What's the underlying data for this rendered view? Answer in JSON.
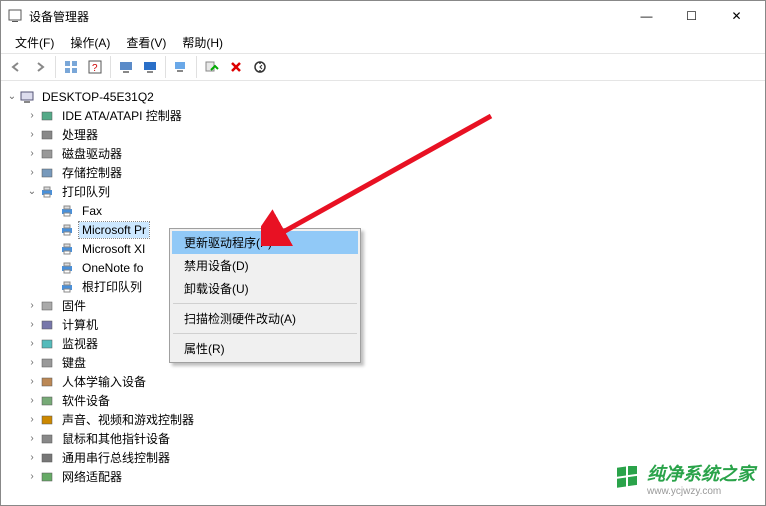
{
  "window": {
    "title": "设备管理器",
    "controls": {
      "min": "—",
      "max": "☐",
      "close": "✕"
    }
  },
  "menubar": [
    {
      "label": "文件(F)"
    },
    {
      "label": "操作(A)"
    },
    {
      "label": "查看(V)"
    },
    {
      "label": "帮助(H)"
    }
  ],
  "toolbar_icons": [
    "nav-back",
    "nav-fwd",
    "properties-grid",
    "help-pane",
    "scan-monitor",
    "scan-blue",
    "devices-view",
    "monitor-settings",
    "uninstall-green",
    "delete-red",
    "refresh-circle"
  ],
  "tree": {
    "root": {
      "label": "DESKTOP-45E31Q2",
      "expanded": true
    },
    "children": [
      {
        "label": "IDE ATA/ATAPI 控制器",
        "icon": "chip",
        "expanded": false
      },
      {
        "label": "处理器",
        "icon": "cpu",
        "expanded": false
      },
      {
        "label": "磁盘驱动器",
        "icon": "disk",
        "expanded": false
      },
      {
        "label": "存储控制器",
        "icon": "storage",
        "expanded": false
      },
      {
        "label": "打印队列",
        "icon": "printer",
        "expanded": true,
        "children": [
          {
            "label": "Fax",
            "icon": "printer"
          },
          {
            "label": "Microsoft Pr",
            "icon": "printer",
            "selected": true
          },
          {
            "label": "Microsoft XI",
            "icon": "printer"
          },
          {
            "label": "OneNote fo",
            "icon": "printer"
          },
          {
            "label": "根打印队列",
            "icon": "printer"
          }
        ]
      },
      {
        "label": "固件",
        "icon": "firmware",
        "expanded": false
      },
      {
        "label": "计算机",
        "icon": "computer",
        "expanded": false
      },
      {
        "label": "监视器",
        "icon": "monitor",
        "expanded": false
      },
      {
        "label": "键盘",
        "icon": "keyboard",
        "expanded": false
      },
      {
        "label": "人体学输入设备",
        "icon": "hid",
        "expanded": false
      },
      {
        "label": "软件设备",
        "icon": "software",
        "expanded": false
      },
      {
        "label": "声音、视频和游戏控制器",
        "icon": "sound",
        "expanded": false
      },
      {
        "label": "鼠标和其他指针设备",
        "icon": "mouse",
        "expanded": false
      },
      {
        "label": "通用串行总线控制器",
        "icon": "usb",
        "expanded": false
      },
      {
        "label": "网络适配器",
        "icon": "network",
        "expanded": false
      }
    ]
  },
  "context_menu": {
    "items": [
      {
        "label": "更新驱动程序(P)",
        "hover": true
      },
      {
        "label": "禁用设备(D)"
      },
      {
        "label": "卸载设备(U)"
      },
      {
        "sep": true
      },
      {
        "label": "扫描检测硬件改动(A)"
      },
      {
        "sep": true
      },
      {
        "label": "属性(R)"
      }
    ]
  },
  "watermark": {
    "text": "纯净系统之家",
    "url": "www.ycjwzy.com"
  }
}
